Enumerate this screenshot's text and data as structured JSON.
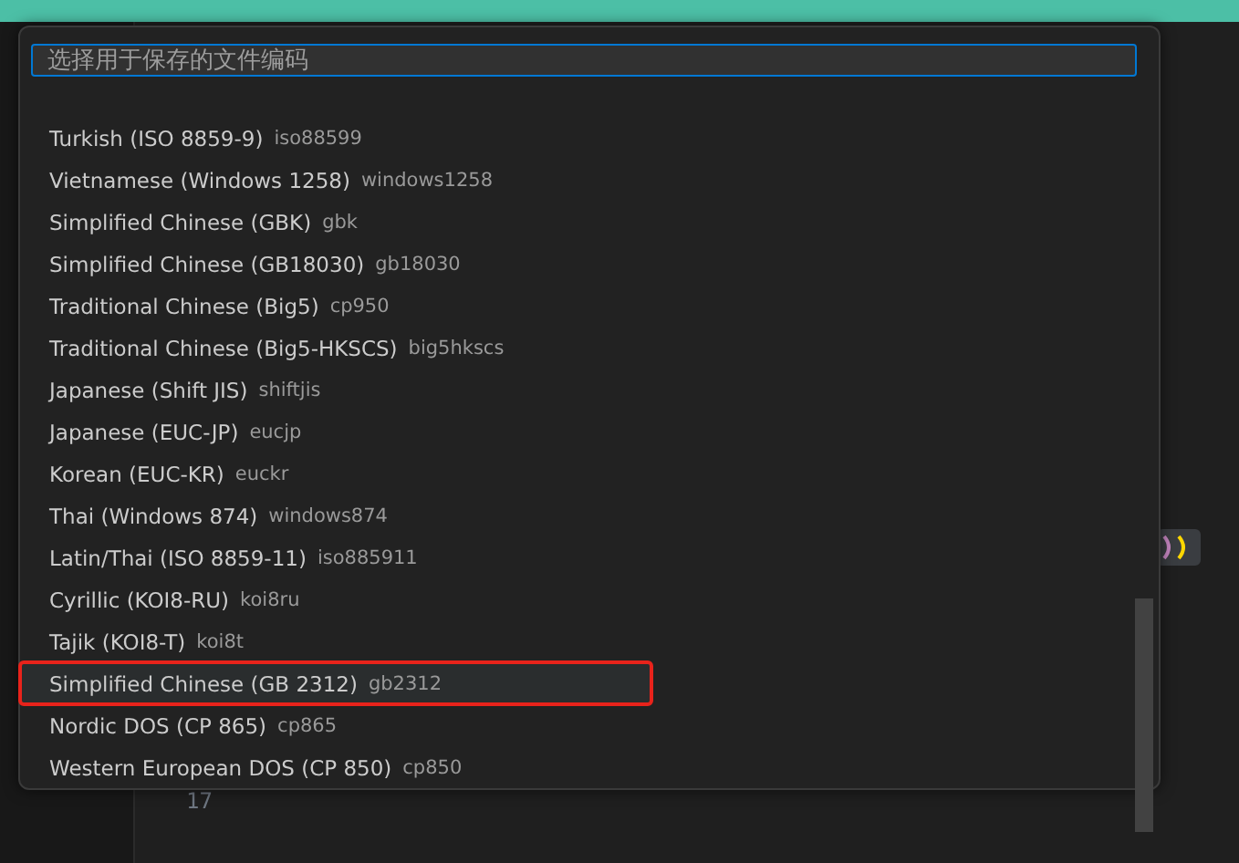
{
  "quick_pick": {
    "placeholder": "选择用于保存的文件编码",
    "items": [
      {
        "label": "Turkish (ISO 8859-9)",
        "code": "iso88599",
        "selected": false,
        "outlined": false
      },
      {
        "label": "Vietnamese (Windows 1258)",
        "code": "windows1258",
        "selected": false,
        "outlined": false
      },
      {
        "label": "Simplified Chinese (GBK)",
        "code": "gbk",
        "selected": false,
        "outlined": false
      },
      {
        "label": "Simplified Chinese (GB18030)",
        "code": "gb18030",
        "selected": false,
        "outlined": false
      },
      {
        "label": "Traditional Chinese (Big5)",
        "code": "cp950",
        "selected": false,
        "outlined": false
      },
      {
        "label": "Traditional Chinese (Big5-HKSCS)",
        "code": "big5hkscs",
        "selected": false,
        "outlined": false
      },
      {
        "label": "Japanese (Shift JIS)",
        "code": "shiftjis",
        "selected": false,
        "outlined": false
      },
      {
        "label": "Japanese (EUC-JP)",
        "code": "eucjp",
        "selected": false,
        "outlined": false
      },
      {
        "label": "Korean (EUC-KR)",
        "code": "euckr",
        "selected": false,
        "outlined": false
      },
      {
        "label": "Thai (Windows 874)",
        "code": "windows874",
        "selected": false,
        "outlined": false
      },
      {
        "label": "Latin/Thai (ISO 8859-11)",
        "code": "iso885911",
        "selected": false,
        "outlined": false
      },
      {
        "label": "Cyrillic (KOI8-RU)",
        "code": "koi8ru",
        "selected": false,
        "outlined": false
      },
      {
        "label": "Tajik (KOI8-T)",
        "code": "koi8t",
        "selected": false,
        "outlined": false
      },
      {
        "label": "Simplified Chinese (GB 2312)",
        "code": "gb2312",
        "selected": true,
        "outlined": true
      },
      {
        "label": "Nordic DOS (CP 865)",
        "code": "cp865",
        "selected": false,
        "outlined": false
      },
      {
        "label": "Western European DOS (CP 850)",
        "code": "cp850",
        "selected": false,
        "outlined": false
      }
    ]
  },
  "editor": {
    "line_number": "17"
  }
}
